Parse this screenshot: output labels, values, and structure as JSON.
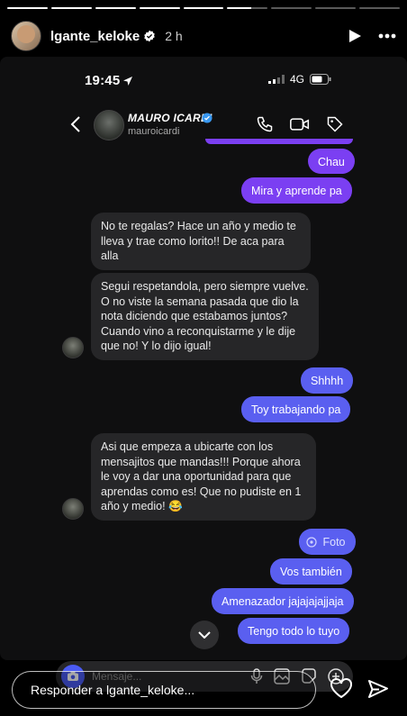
{
  "story": {
    "username": "lgante_keloke",
    "time": "2 h",
    "progress_segments": 9,
    "completed_segments": 5,
    "reply_placeholder": "Responder a lgante_keloke..."
  },
  "status_bar": {
    "time": "19:45",
    "network": "4G"
  },
  "chat": {
    "name": "MAURO ICARDI",
    "handle": "mauroicardi",
    "compose_placeholder": "Mensaje...",
    "messages": [
      {
        "side": "out",
        "text": "Chau"
      },
      {
        "side": "out",
        "text": "Mira y aprende pa"
      },
      {
        "side": "in",
        "text": "No te regalas? Hace un año y medio te lleva y trae como lorito!! De aca para alla"
      },
      {
        "side": "in",
        "text": "Segui respetandola, pero siempre vuelve. O no viste la semana pasada que dio la nota diciendo que estabamos juntos? Cuando vino a reconquistarme y le dije que no! Y lo dijo igual!"
      },
      {
        "side": "out",
        "text": "Shhhh"
      },
      {
        "side": "out",
        "text": "Toy trabajando pa"
      },
      {
        "side": "in",
        "text": "Asi que empeza a ubicarte con los mensajitos que mandas!!! Porque ahora le voy a dar una oportunidad para que aprendas como es! Que no pudiste en 1 año y medio! 😂"
      },
      {
        "side": "out",
        "text": "Foto"
      },
      {
        "side": "out",
        "text": "Vos también"
      },
      {
        "side": "out",
        "text": "Amenazador jajajajajjaja"
      },
      {
        "side": "out",
        "text": "Tengo todo lo tuyo"
      }
    ]
  },
  "colors": {
    "outgoing_purple": "#7b3ff2",
    "outgoing_blue": "#5a5ff0",
    "incoming_gray": "#262628",
    "verified_blue": "#3897f0"
  }
}
